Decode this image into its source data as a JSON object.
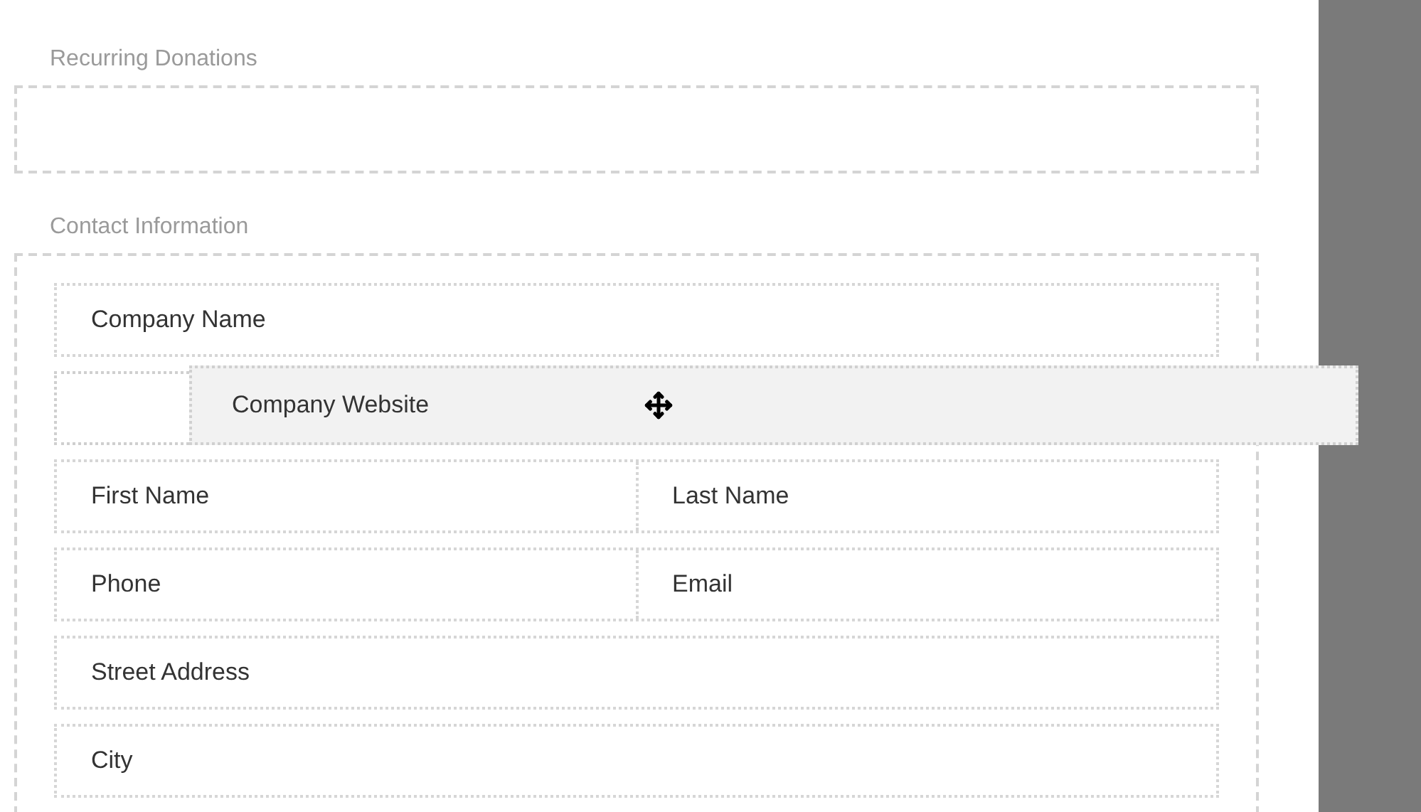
{
  "sections": [
    {
      "title": "Recurring Donations"
    },
    {
      "title": "Contact Information",
      "rows": [
        {
          "kind": "field",
          "fields": [
            "Company Name"
          ]
        },
        {
          "kind": "placeholder",
          "fields": []
        },
        {
          "kind": "field",
          "fields": [
            "First Name",
            "Last Name"
          ]
        },
        {
          "kind": "field",
          "fields": [
            "Phone",
            "Email"
          ]
        },
        {
          "kind": "field",
          "fields": [
            "Street Address"
          ]
        },
        {
          "kind": "field",
          "fields": [
            "City"
          ]
        }
      ]
    }
  ],
  "dragged_item": {
    "label": "Company Website"
  }
}
